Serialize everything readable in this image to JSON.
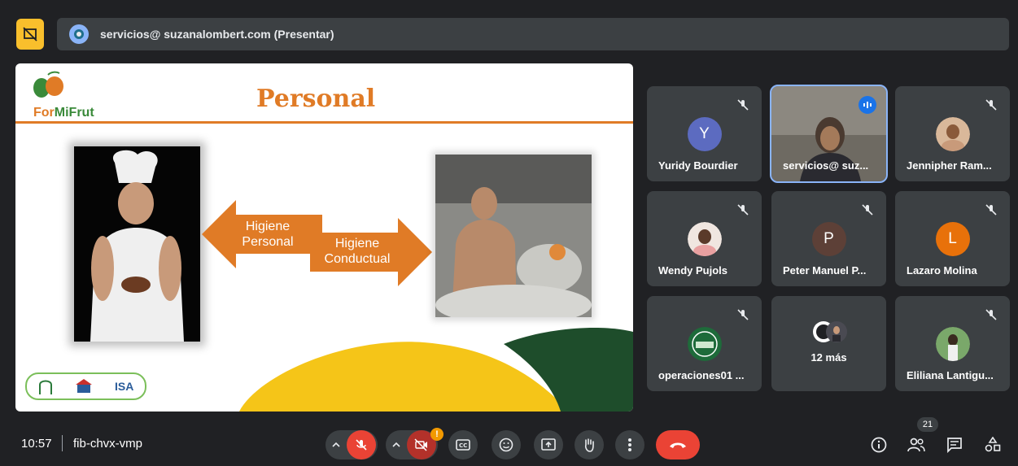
{
  "presenter": {
    "banner_text": "servicios@ suzanalombert.com (Presentar)"
  },
  "slide": {
    "title": "Personal",
    "logo_text_a": "For",
    "logo_text_b": "MiFrut",
    "arrow_left_line1": "Higiene",
    "arrow_left_line2": "Personal",
    "arrow_right_line1": "Higiene",
    "arrow_right_line2": "Conductual",
    "org_logo_text": "ISA"
  },
  "participants": [
    {
      "name": "Yuridy Bourdier",
      "initial": "Y",
      "avatar_color": "#5c6bc0",
      "muted": true
    },
    {
      "name": "servicios@ suz...",
      "initial": "",
      "speaking": true,
      "muted": false
    },
    {
      "name": "Jennipher Ram...",
      "initial": "",
      "muted": true
    },
    {
      "name": "Wendy Pujols",
      "initial": "",
      "muted": true
    },
    {
      "name": "Peter Manuel P...",
      "initial": "P",
      "avatar_color": "#5d4037",
      "muted": true
    },
    {
      "name": "Lazaro Molina",
      "initial": "L",
      "avatar_color": "#e8710a",
      "muted": true
    },
    {
      "name": "operaciones01 ...",
      "initial": "",
      "muted": true
    },
    {
      "name": "12 más",
      "initial": "",
      "muted": false
    },
    {
      "name": "Eliliana Lantigu...",
      "initial": "",
      "muted": true
    }
  ],
  "bottombar": {
    "time": "10:57",
    "meeting_code": "fib-chvx-vmp",
    "participant_count": "21",
    "camera_warning": "!"
  },
  "icons": {
    "stop_presenting": "present-off-icon",
    "mic": "mic-off-icon",
    "camera": "camera-off-icon",
    "captions": "captions-icon",
    "emoji": "emoji-icon",
    "present": "present-icon",
    "hand": "raise-hand-icon",
    "more": "more-vert-icon",
    "hangup": "call-end-icon",
    "info": "info-icon",
    "people": "people-icon",
    "chat": "chat-icon",
    "activities": "activities-icon"
  },
  "colors": {
    "accent_orange": "#e07b26",
    "danger_red": "#ea4335",
    "present_yellow": "#f9bf2c",
    "speaking_blue": "#8ab4f8"
  }
}
